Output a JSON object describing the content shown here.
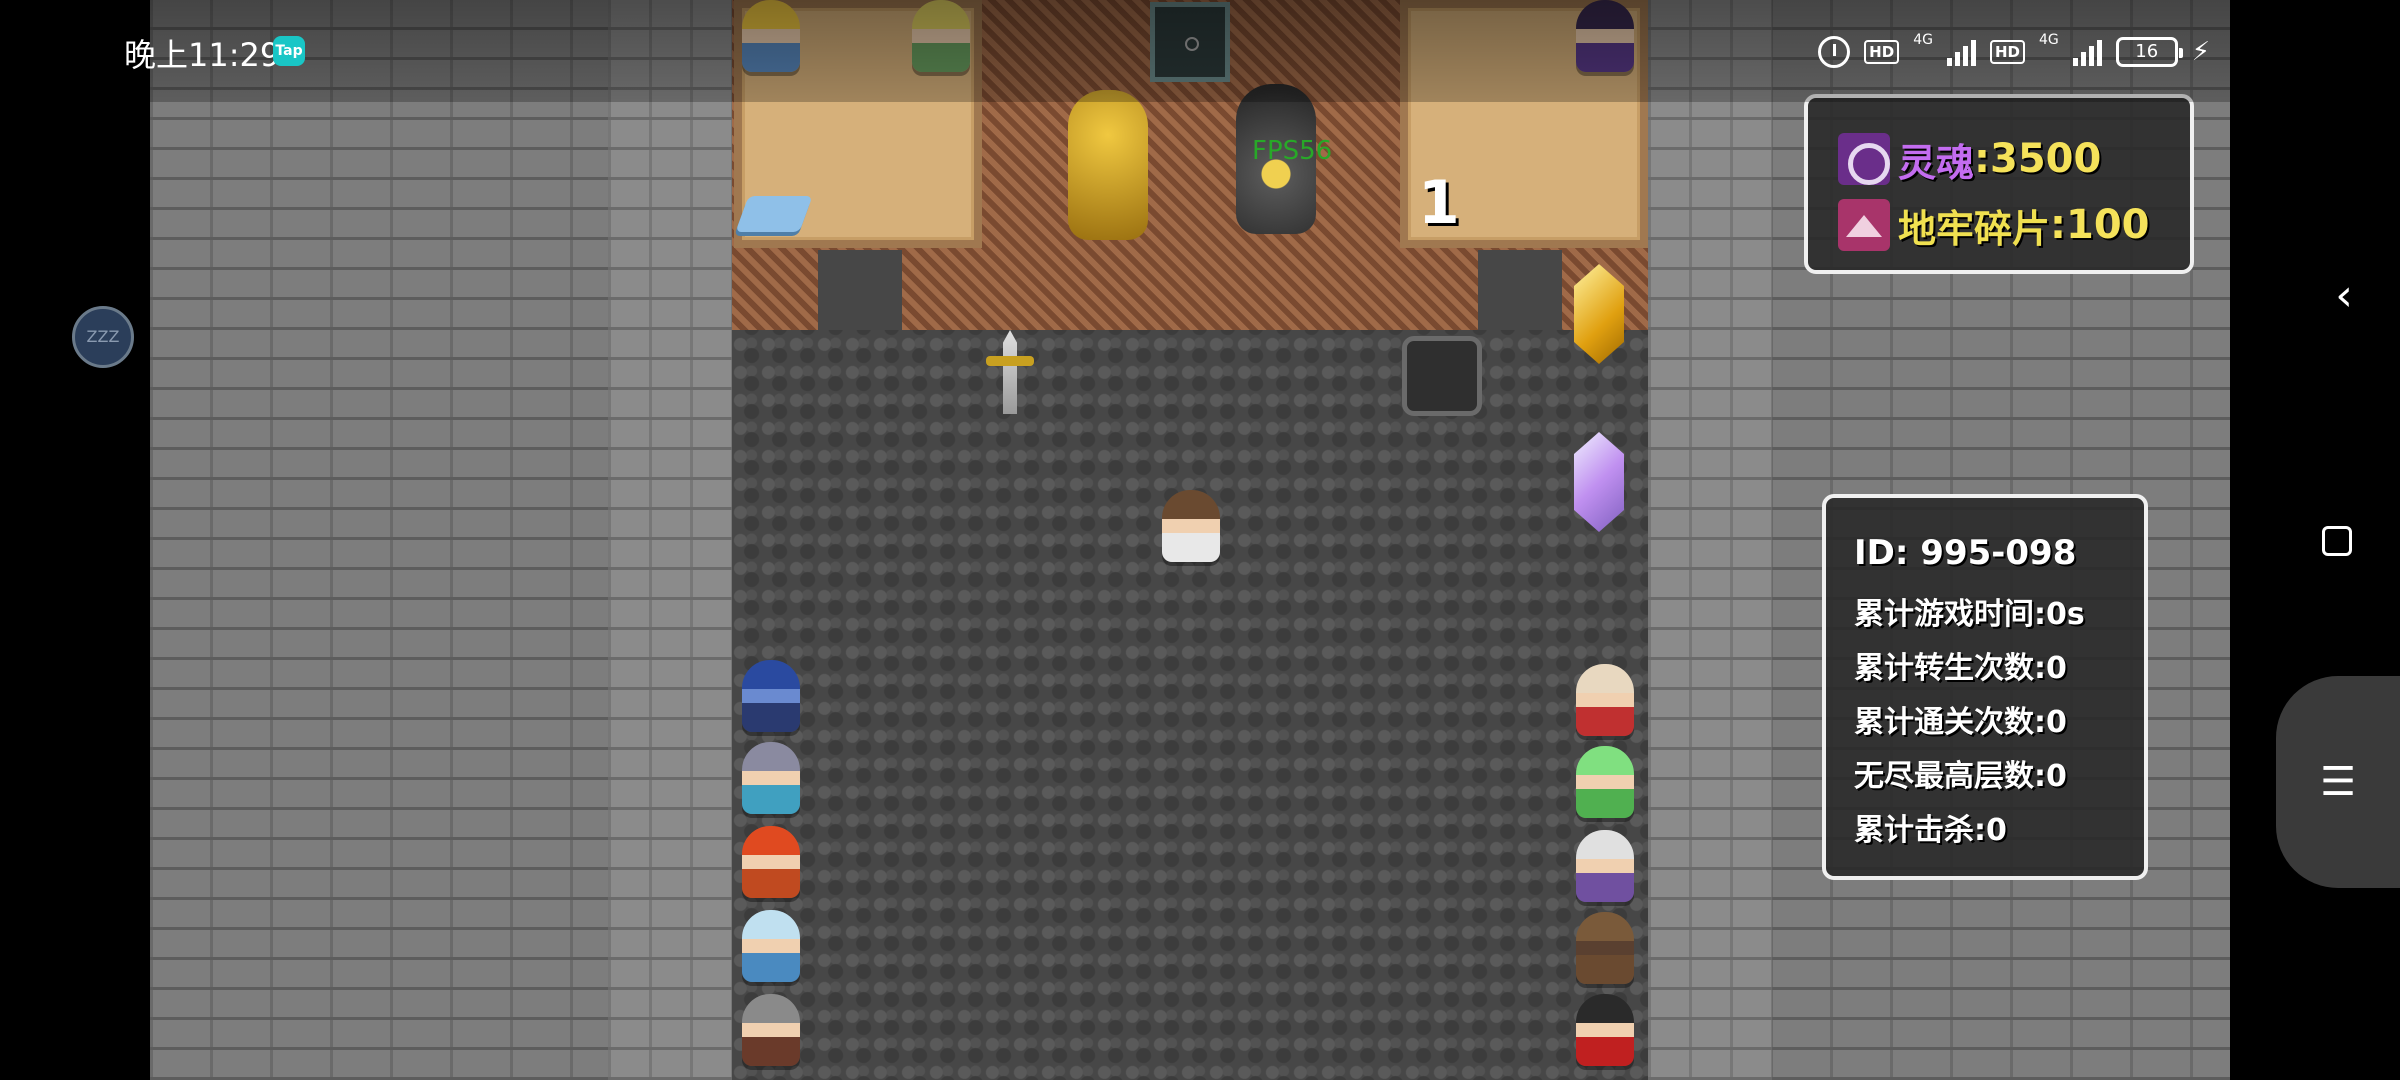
{
  "status_bar": {
    "time": "晚上11:29",
    "tap_badge": "Tap",
    "hd1": "HD",
    "net1": "4G",
    "hd2": "HD",
    "net2": "4G",
    "battery": "16"
  },
  "game": {
    "fps": "FPS56",
    "floor_number": "1"
  },
  "currency": {
    "soul_label": "灵魂",
    "soul_value": ":3500",
    "fragment_label": "地牢碎片",
    "fragment_value": ":100"
  },
  "stats": {
    "id": "ID: 995-098",
    "play_time": "累计游戏时间:0s",
    "rebirths": "累计转生次数:0",
    "clears": "累计通关次数:0",
    "endless_top": "无尽最高层数:0",
    "kills": "累计击杀:0"
  },
  "float_button": "ZZZ",
  "navigation": {
    "back_icon": "chevron-left-icon",
    "home_icon": "square-icon",
    "menu_icon": "hamburger-icon"
  },
  "colors": {
    "soul_label": "#c36cf0",
    "value_gold": "#f5e25a",
    "fps_green": "#28a828",
    "panel_border": "#f0f0f0"
  }
}
